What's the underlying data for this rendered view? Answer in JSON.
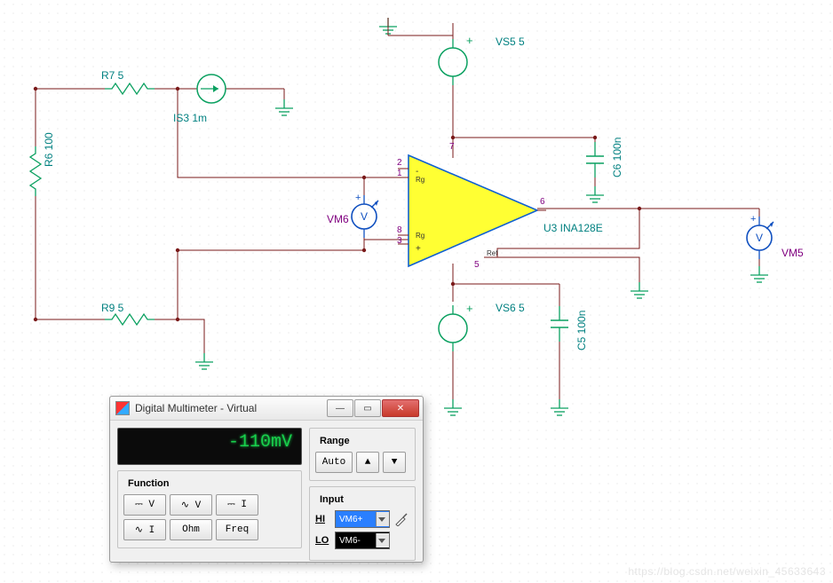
{
  "components": {
    "R7": "R7 5",
    "R6": "R6 100",
    "R9": "R9 5",
    "IS3": "IS3 1m",
    "VS5": "VS5 5",
    "VS6": "VS6 5",
    "C6": "C6 100n",
    "C5": "C5 100n",
    "U3": "U3 INA128E",
    "VM6": "VM6",
    "VM5": "VM5"
  },
  "pins": {
    "opamp": {
      "p1": "1",
      "p2": "2",
      "p3": "3",
      "p5": "5",
      "p6": "6",
      "p7": "7",
      "p8": "8",
      "rg_top": "Rg",
      "rg_bot": "Rg",
      "ref": "Ref",
      "plus": "+",
      "minus": "-"
    }
  },
  "multimeter": {
    "title": "Digital Multimeter - Virtual",
    "reading": "-110mV",
    "groups": {
      "function": "Function",
      "range": "Range",
      "input": "Input"
    },
    "functions": {
      "dcv": "⎓ V",
      "acv": "∿ V",
      "dci": "⎓ I",
      "aci": "∿ I",
      "ohm": "Ohm",
      "freq": "Freq"
    },
    "range": {
      "auto": "Auto",
      "up": "▲",
      "down": "▼"
    },
    "input": {
      "hi_label": "HI",
      "lo_label": "LO",
      "hi_value": "VM6+",
      "lo_value": "VM6-"
    }
  },
  "watermark": "https://blog.csdn.net/weixin_45633643"
}
